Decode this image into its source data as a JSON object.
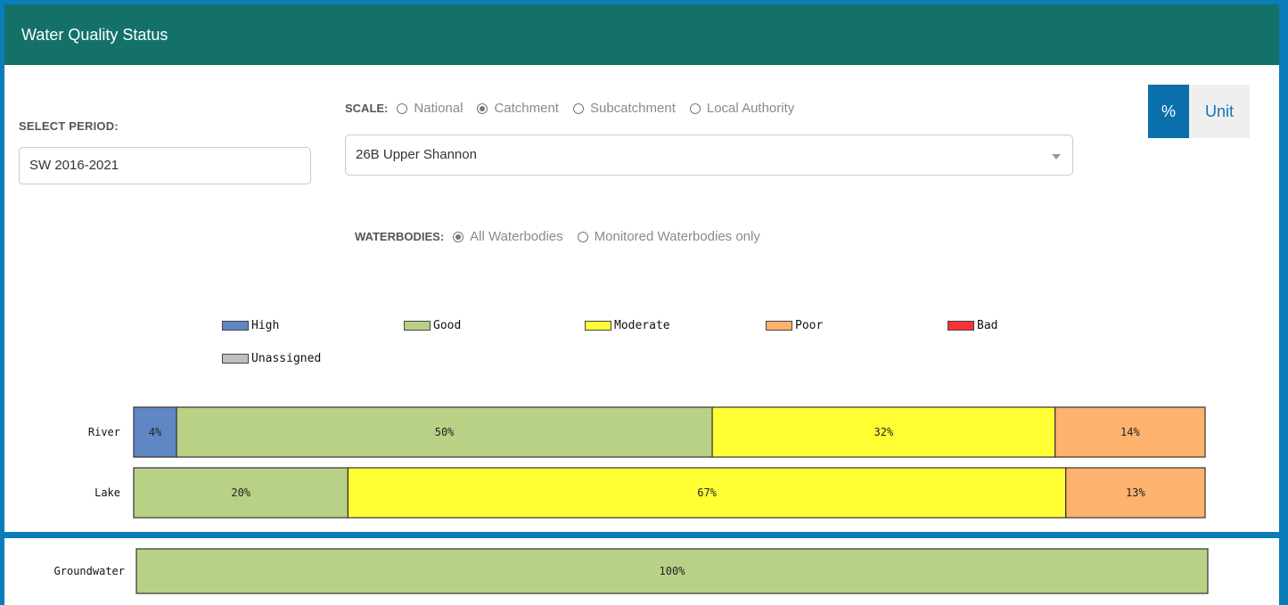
{
  "header": {
    "title": "Water Quality Status"
  },
  "period": {
    "label": "SELECT PERIOD:",
    "value": "SW 2016-2021"
  },
  "scale": {
    "label": "SCALE:",
    "options": [
      "National",
      "Catchment",
      "Subcatchment",
      "Local Authority"
    ],
    "selected": "Catchment",
    "value": "26B Upper Shannon"
  },
  "units_toggle": {
    "percent_label": "%",
    "unit_label": "Unit",
    "active": "%"
  },
  "waterbodies": {
    "label": "WATERBODIES:",
    "options": [
      "All Waterbodies",
      "Monitored Waterbodies only"
    ],
    "selected": "All Waterbodies"
  },
  "colors": {
    "header_bg": "#13716a",
    "page_bg": "#0a7db8",
    "High": "#5f87c4",
    "Good": "#b8d185",
    "Moderate": "#ffff33",
    "Poor": "#fdb26d",
    "Bad": "#f43338",
    "Unassigned": "#bfbfbf"
  },
  "chart_data": {
    "type": "bar",
    "orientation": "horizontal",
    "stacked": true,
    "legend": [
      "High",
      "Good",
      "Moderate",
      "Poor",
      "Bad",
      "Unassigned"
    ],
    "legend_position": "top",
    "categories": [
      "River",
      "Lake",
      "Groundwater"
    ],
    "series": [
      {
        "name": "High",
        "values": [
          4,
          0,
          0
        ]
      },
      {
        "name": "Good",
        "values": [
          50,
          20,
          100
        ]
      },
      {
        "name": "Moderate",
        "values": [
          32,
          67,
          0
        ]
      },
      {
        "name": "Poor",
        "values": [
          14,
          13,
          0
        ]
      },
      {
        "name": "Bad",
        "values": [
          0,
          0,
          0
        ]
      },
      {
        "name": "Unassigned",
        "values": [
          0,
          0,
          0
        ]
      }
    ],
    "data_labels": [
      [
        "4%",
        "50%",
        "32%",
        "14%"
      ],
      [
        "20%",
        "67%",
        "13%"
      ],
      [
        "100%"
      ]
    ],
    "xlim": [
      0,
      100
    ],
    "unit": "%"
  }
}
